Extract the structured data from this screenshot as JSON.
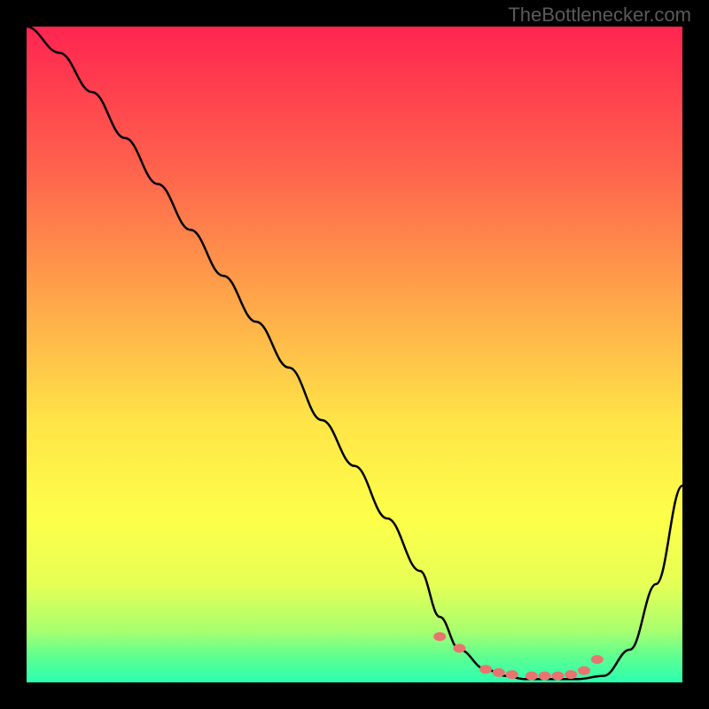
{
  "watermark": "TheBottlenecker.com",
  "chart_data": {
    "type": "line",
    "title": "",
    "xlabel": "",
    "ylabel": "",
    "xlim": [
      0,
      100
    ],
    "ylim": [
      0,
      100
    ],
    "series": [
      {
        "name": "bottleneck-curve",
        "x": [
          0,
          5,
          10,
          15,
          20,
          25,
          30,
          35,
          40,
          45,
          50,
          55,
          60,
          63,
          66,
          70,
          73,
          76,
          80,
          84,
          88,
          92,
          96,
          100
        ],
        "y": [
          100,
          96,
          90,
          83,
          76,
          69,
          62,
          55,
          48,
          40,
          33,
          25,
          17,
          10,
          5,
          2,
          1,
          0.5,
          0.5,
          0.5,
          1,
          5,
          15,
          30
        ]
      }
    ],
    "markers": {
      "name": "highlight-dots",
      "x": [
        63,
        66,
        70,
        72,
        74,
        77,
        79,
        81,
        83,
        85,
        87
      ],
      "y": [
        7,
        5.2,
        2,
        1.5,
        1.2,
        1,
        1,
        1,
        1.2,
        1.8,
        3.5
      ],
      "color": "#e8746f"
    },
    "gradient_stops": [
      {
        "pct": 0,
        "color": "#ff2550"
      },
      {
        "pct": 20,
        "color": "#ff5d4d"
      },
      {
        "pct": 40,
        "color": "#ffa04a"
      },
      {
        "pct": 60,
        "color": "#ffe448"
      },
      {
        "pct": 75,
        "color": "#fdff49"
      },
      {
        "pct": 85,
        "color": "#e6ff55"
      },
      {
        "pct": 92,
        "color": "#aaff6f"
      },
      {
        "pct": 96,
        "color": "#5fff90"
      },
      {
        "pct": 100,
        "color": "#2bffb0"
      }
    ]
  }
}
